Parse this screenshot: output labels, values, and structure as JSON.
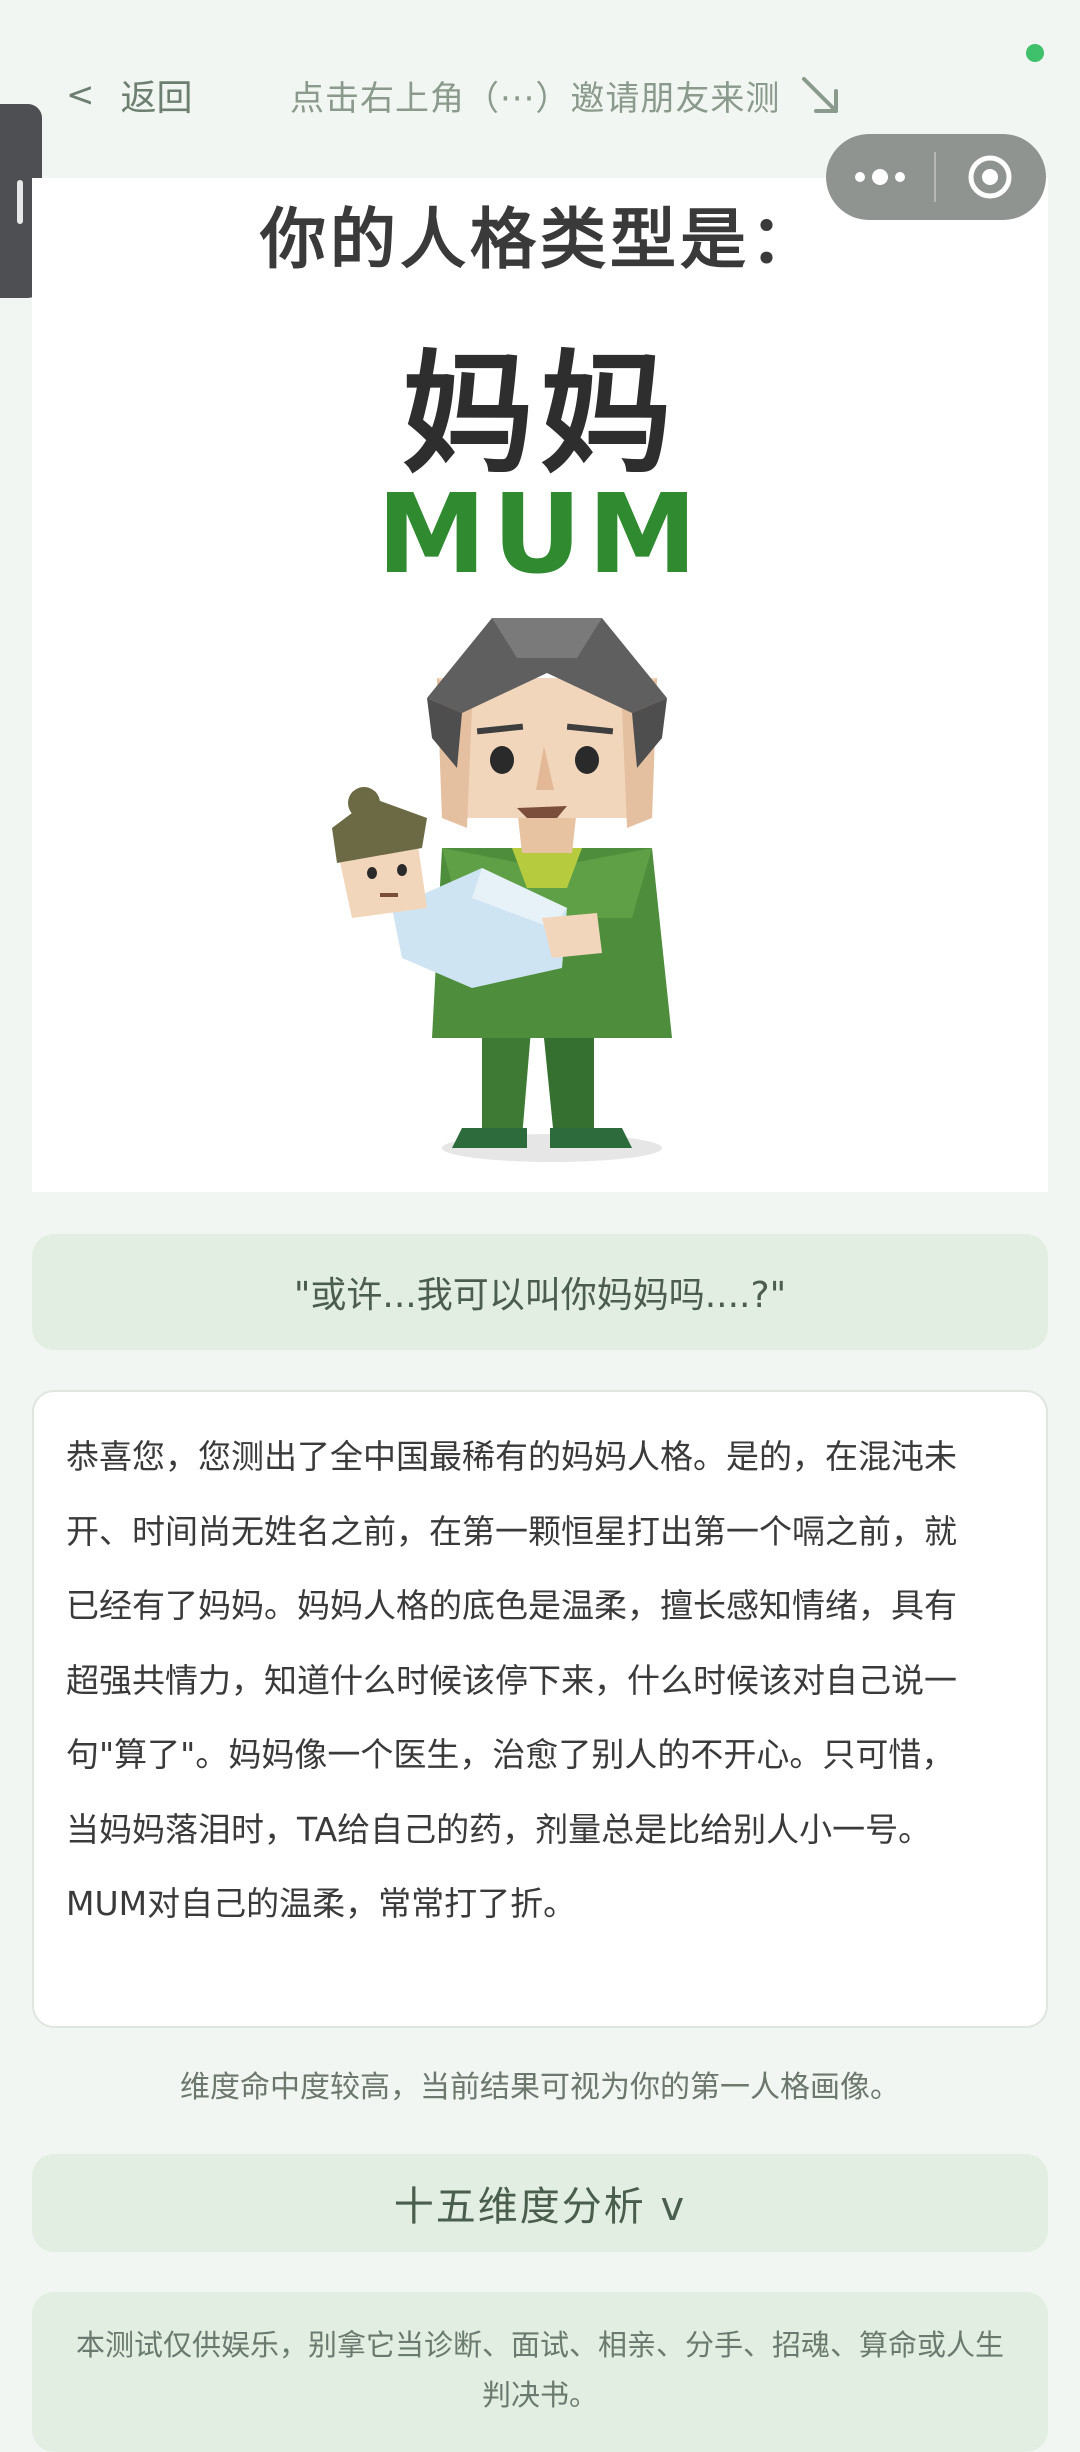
{
  "nav": {
    "back_label": "返回",
    "back_chevron": "<",
    "invite_hint": "点击右上角（···）邀请朋友来测"
  },
  "hero": {
    "line1": "你的人格类型是：",
    "type_cn": "妈妈",
    "type_en": "MUM"
  },
  "quote": "\"或许...我可以叫你妈妈吗....?\"",
  "description": "恭喜您，您测出了全中国最稀有的妈妈人格。是的，在混沌未开、时间尚无姓名之前，在第一颗恒星打出第一个嗝之前，就已经有了妈妈。妈妈人格的底色是温柔，擅长感知情绪，具有超强共情力，知道什么时候该停下来，什么时候该对自己说一句\"算了\"。妈妈像一个医生，治愈了别人的不开心。只可惜，当妈妈落泪时，TA给自己的药，剂量总是比给别人小一号。MUM对自己的温柔，常常打了折。",
  "hint": "维度命中度较高，当前结果可视为你的第一人格画像。",
  "analysis_label": "十五维度分析 v",
  "disclaimer": "本测试仅供娱乐，别拿它当诊断、面试、相亲、分手、招魂、算命或人生判决书。",
  "colors": {
    "accent_green": "#2f8a30",
    "panel_green": "#e3eee3",
    "background": "#f2f6f2",
    "status_dot": "#3fc06a"
  },
  "icons": {
    "more": "more-dots-icon",
    "close": "target-close-icon",
    "arrow": "arrow-down-right-icon",
    "handle": "side-handle-icon"
  }
}
